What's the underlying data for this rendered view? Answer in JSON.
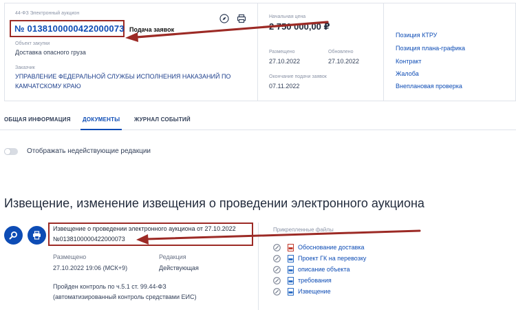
{
  "header": {
    "law_type": "44-ФЗ Электронный аукцион",
    "reg_number": "№ 0138100000422000073",
    "status": "Подача заявок",
    "object_label": "Объект закупки",
    "object_value": "Доставка опасного груза",
    "customer_label": "Заказчик",
    "customer_line1": "УПРАВЛЕНИЕ ФЕДЕРАЛЬНОЙ СЛУЖБЫ ИСПОЛНЕНИЯ НАКАЗАНИЙ ПО",
    "customer_line2": "КАМЧАТСКОМУ КРАЮ",
    "price_label": "Начальная цена",
    "price_value": "2 750 000,00 ₽",
    "posted_label": "Размещено",
    "posted_value": "27.10.2022",
    "updated_label": "Обновлено",
    "updated_value": "27.10.2022",
    "deadline_label": "Окончание подачи заявок",
    "deadline_value": "07.11.2022",
    "links": [
      "Позиция КТРУ",
      "Позиция плана-графика",
      "Контракт",
      "Жалоба",
      "Внеплановая проверка"
    ]
  },
  "tabs": [
    "ОБЩАЯ ИНФОРМАЦИЯ",
    "ДОКУМЕНТЫ",
    "ЖУРНАЛ СОБЫТИЙ"
  ],
  "active_tab": "ДОКУМЕНТЫ",
  "toggle_label": "Отображать недействующие редакции",
  "section_title": "Извещение, изменение извещения о проведении электронного аукциона",
  "document": {
    "title_line1": "Извещение о проведении электронного аукциона от 27.10.2022",
    "title_line2": "№0138100000422000073",
    "posted_label": "Размещено",
    "posted_value": "27.10.2022 19:06 (МСК+9)",
    "edition_label": "Редакция",
    "edition_value": "Действующая",
    "control_line1": "Пройден контроль по ч.5.1 ст. 99.44-ФЗ",
    "control_line2": "(автоматизированный контроль средствами ЕИС)"
  },
  "attached": {
    "label": "Прикрепленные файлы",
    "files": [
      "Обоснование доставка",
      "Проект ГК на перевозку",
      "описание объекта",
      "требования",
      "Извещение"
    ]
  },
  "colors": {
    "accent": "#0d4cb5",
    "annotation": "#9c2a25",
    "text": "#334059",
    "muted": "#8a93a6"
  },
  "icons": [
    "compass-icon",
    "print-icon",
    "search-icon",
    "pin-icon",
    "pdf-file-icon",
    "doc-file-icon"
  ]
}
